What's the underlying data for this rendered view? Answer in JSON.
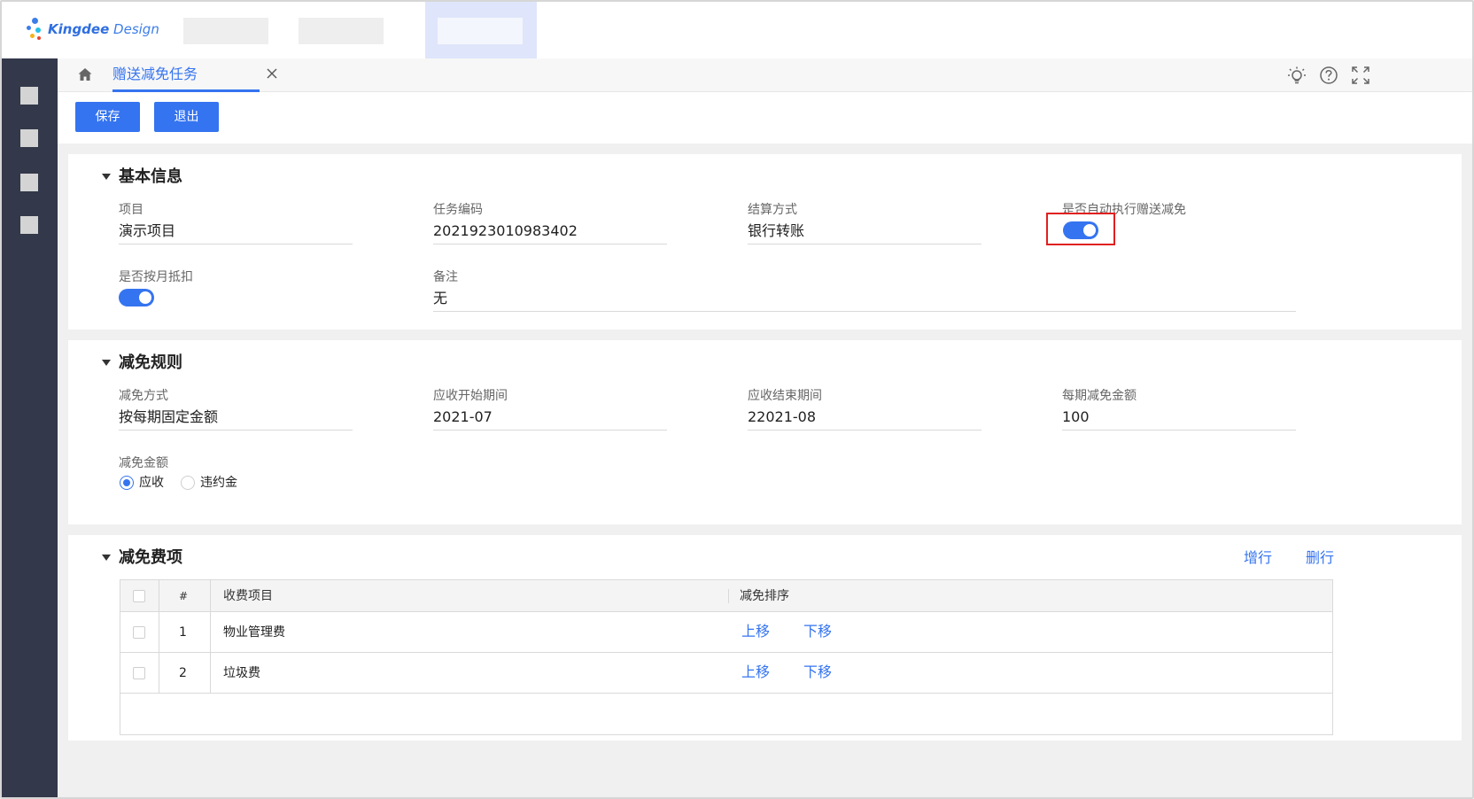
{
  "app": {
    "logo_brand": "Kingdee",
    "logo_suffix": "Design"
  },
  "tabstrip": {
    "active_tab": "赠送减免任务",
    "icons": [
      "home-icon",
      "close-icon",
      "bulb-icon",
      "help-icon",
      "fullscreen-icon"
    ]
  },
  "toolbar": {
    "save_label": "保存",
    "exit_label": "退出"
  },
  "basic_info": {
    "title": "基本信息",
    "project_label": "项目",
    "project_value": "演示项目",
    "code_label": "任务编码",
    "code_value": "2021923010983402",
    "settle_label": "结算方式",
    "settle_value": "银行转账",
    "auto_label": "是否自动执行赠送减免",
    "auto_on": true,
    "monthly_label": "是否按月抵扣",
    "monthly_on": true,
    "remark_label": "备注",
    "remark_value": "无"
  },
  "rules": {
    "title": "减免规则",
    "method_label": "减免方式",
    "method_value": "按每期固定金额",
    "start_label": "应收开始期间",
    "start_value": "2021-07",
    "end_label": "应收结束期间",
    "end_value": "22021-08",
    "per_label": "每期减免金额",
    "per_value": "100",
    "amount_label": "减免金额",
    "option_receivable": "应收",
    "option_penalty": "违约金",
    "selected": "应收"
  },
  "fees": {
    "title": "减免费项",
    "add_row": "增行",
    "delete_row": "删行",
    "columns": [
      "#",
      "收费项目",
      "减免排序"
    ],
    "rows": [
      {
        "index": "1",
        "item": "物业管理费",
        "up": "上移",
        "down": "下移"
      },
      {
        "index": "2",
        "item": "垃圾费",
        "up": "上移",
        "down": "下移"
      }
    ]
  },
  "colors": {
    "primary": "#3574f0",
    "sidebar": "#33384a",
    "highlight": "#e02020"
  }
}
